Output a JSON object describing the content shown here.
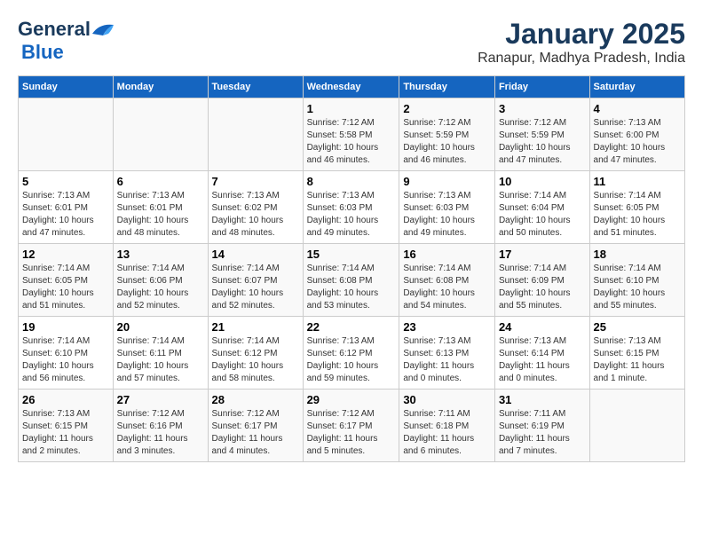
{
  "logo": {
    "line1": "General",
    "line2": "Blue"
  },
  "title": "January 2025",
  "subtitle": "Ranapur, Madhya Pradesh, India",
  "days_of_week": [
    "Sunday",
    "Monday",
    "Tuesday",
    "Wednesday",
    "Thursday",
    "Friday",
    "Saturday"
  ],
  "weeks": [
    [
      {
        "day": "",
        "info": ""
      },
      {
        "day": "",
        "info": ""
      },
      {
        "day": "",
        "info": ""
      },
      {
        "day": "1",
        "info": "Sunrise: 7:12 AM\nSunset: 5:58 PM\nDaylight: 10 hours\nand 46 minutes."
      },
      {
        "day": "2",
        "info": "Sunrise: 7:12 AM\nSunset: 5:59 PM\nDaylight: 10 hours\nand 46 minutes."
      },
      {
        "day": "3",
        "info": "Sunrise: 7:12 AM\nSunset: 5:59 PM\nDaylight: 10 hours\nand 47 minutes."
      },
      {
        "day": "4",
        "info": "Sunrise: 7:13 AM\nSunset: 6:00 PM\nDaylight: 10 hours\nand 47 minutes."
      }
    ],
    [
      {
        "day": "5",
        "info": "Sunrise: 7:13 AM\nSunset: 6:01 PM\nDaylight: 10 hours\nand 47 minutes."
      },
      {
        "day": "6",
        "info": "Sunrise: 7:13 AM\nSunset: 6:01 PM\nDaylight: 10 hours\nand 48 minutes."
      },
      {
        "day": "7",
        "info": "Sunrise: 7:13 AM\nSunset: 6:02 PM\nDaylight: 10 hours\nand 48 minutes."
      },
      {
        "day": "8",
        "info": "Sunrise: 7:13 AM\nSunset: 6:03 PM\nDaylight: 10 hours\nand 49 minutes."
      },
      {
        "day": "9",
        "info": "Sunrise: 7:13 AM\nSunset: 6:03 PM\nDaylight: 10 hours\nand 49 minutes."
      },
      {
        "day": "10",
        "info": "Sunrise: 7:14 AM\nSunset: 6:04 PM\nDaylight: 10 hours\nand 50 minutes."
      },
      {
        "day": "11",
        "info": "Sunrise: 7:14 AM\nSunset: 6:05 PM\nDaylight: 10 hours\nand 51 minutes."
      }
    ],
    [
      {
        "day": "12",
        "info": "Sunrise: 7:14 AM\nSunset: 6:05 PM\nDaylight: 10 hours\nand 51 minutes."
      },
      {
        "day": "13",
        "info": "Sunrise: 7:14 AM\nSunset: 6:06 PM\nDaylight: 10 hours\nand 52 minutes."
      },
      {
        "day": "14",
        "info": "Sunrise: 7:14 AM\nSunset: 6:07 PM\nDaylight: 10 hours\nand 52 minutes."
      },
      {
        "day": "15",
        "info": "Sunrise: 7:14 AM\nSunset: 6:08 PM\nDaylight: 10 hours\nand 53 minutes."
      },
      {
        "day": "16",
        "info": "Sunrise: 7:14 AM\nSunset: 6:08 PM\nDaylight: 10 hours\nand 54 minutes."
      },
      {
        "day": "17",
        "info": "Sunrise: 7:14 AM\nSunset: 6:09 PM\nDaylight: 10 hours\nand 55 minutes."
      },
      {
        "day": "18",
        "info": "Sunrise: 7:14 AM\nSunset: 6:10 PM\nDaylight: 10 hours\nand 55 minutes."
      }
    ],
    [
      {
        "day": "19",
        "info": "Sunrise: 7:14 AM\nSunset: 6:10 PM\nDaylight: 10 hours\nand 56 minutes."
      },
      {
        "day": "20",
        "info": "Sunrise: 7:14 AM\nSunset: 6:11 PM\nDaylight: 10 hours\nand 57 minutes."
      },
      {
        "day": "21",
        "info": "Sunrise: 7:14 AM\nSunset: 6:12 PM\nDaylight: 10 hours\nand 58 minutes."
      },
      {
        "day": "22",
        "info": "Sunrise: 7:13 AM\nSunset: 6:12 PM\nDaylight: 10 hours\nand 59 minutes."
      },
      {
        "day": "23",
        "info": "Sunrise: 7:13 AM\nSunset: 6:13 PM\nDaylight: 11 hours\nand 0 minutes."
      },
      {
        "day": "24",
        "info": "Sunrise: 7:13 AM\nSunset: 6:14 PM\nDaylight: 11 hours\nand 0 minutes."
      },
      {
        "day": "25",
        "info": "Sunrise: 7:13 AM\nSunset: 6:15 PM\nDaylight: 11 hours\nand 1 minute."
      }
    ],
    [
      {
        "day": "26",
        "info": "Sunrise: 7:13 AM\nSunset: 6:15 PM\nDaylight: 11 hours\nand 2 minutes."
      },
      {
        "day": "27",
        "info": "Sunrise: 7:12 AM\nSunset: 6:16 PM\nDaylight: 11 hours\nand 3 minutes."
      },
      {
        "day": "28",
        "info": "Sunrise: 7:12 AM\nSunset: 6:17 PM\nDaylight: 11 hours\nand 4 minutes."
      },
      {
        "day": "29",
        "info": "Sunrise: 7:12 AM\nSunset: 6:17 PM\nDaylight: 11 hours\nand 5 minutes."
      },
      {
        "day": "30",
        "info": "Sunrise: 7:11 AM\nSunset: 6:18 PM\nDaylight: 11 hours\nand 6 minutes."
      },
      {
        "day": "31",
        "info": "Sunrise: 7:11 AM\nSunset: 6:19 PM\nDaylight: 11 hours\nand 7 minutes."
      },
      {
        "day": "",
        "info": ""
      }
    ]
  ]
}
